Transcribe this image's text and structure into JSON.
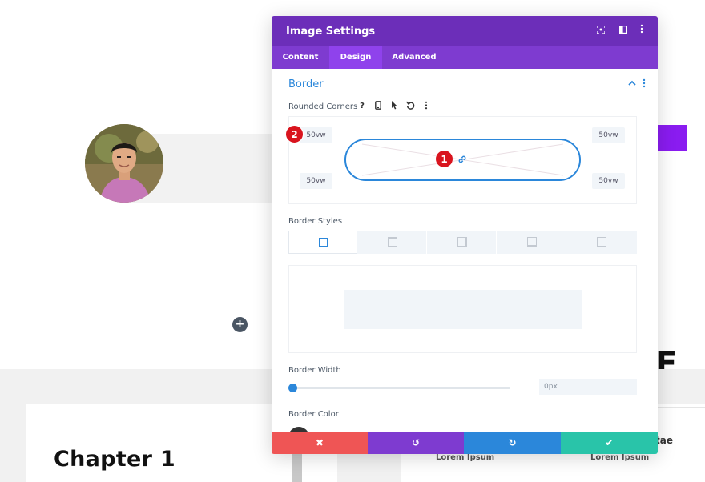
{
  "background": {
    "chapter_title": "Chapter 1",
    "big_letter": "E",
    "partial_text": "tae",
    "lorem_1": "Lorem Ipsum",
    "lorem_2": "Lorem Ipsum",
    "add_glyph": "+"
  },
  "modal": {
    "title": "Image Settings",
    "header_icons": [
      "fullscreen-icon",
      "split-view-icon",
      "more-icon"
    ],
    "tabs": [
      {
        "label": "Content",
        "active": false
      },
      {
        "label": "Design",
        "active": true
      },
      {
        "label": "Advanced",
        "active": false
      }
    ],
    "section": {
      "title": "Border",
      "rounded_corners": {
        "label": "Rounded Corners",
        "help_glyph": "?",
        "top_left": "50vw",
        "top_right": "50vw",
        "bottom_left": "50vw",
        "bottom_right": "50vw"
      },
      "border_styles": {
        "label": "Border Styles",
        "options": [
          "all",
          "top",
          "right",
          "bottom",
          "left"
        ],
        "selected": "all"
      },
      "border_width": {
        "label": "Border Width",
        "value": "0px"
      },
      "border_color": {
        "label": "Border Color"
      }
    },
    "badges": [
      "1",
      "2"
    ],
    "footer": {
      "cancel": "✖",
      "undo": "↺",
      "redo": "↻",
      "save": "✔"
    }
  },
  "colors": {
    "header_purple": "#6c2eb9",
    "tab_purple": "#7e3bd0",
    "active_tab": "#8f42ec",
    "accent_blue": "#2b87da",
    "badge_red": "#d9141e",
    "cancel_red": "#ef5555",
    "undo_purple": "#7e3bd0",
    "redo_blue": "#2b87da",
    "save_green": "#29c4a9"
  }
}
